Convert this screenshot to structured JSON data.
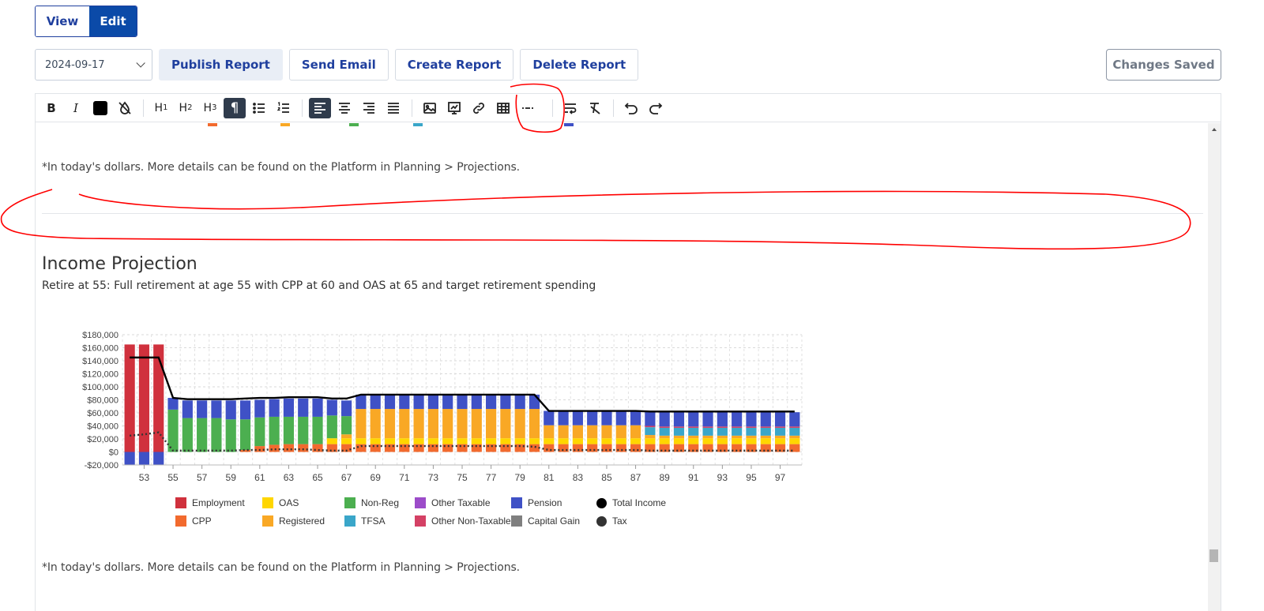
{
  "mode": {
    "view_label": "View",
    "edit_label": "Edit",
    "active": "edit"
  },
  "actions": {
    "date_value": "2024-09-17",
    "publish_label": "Publish Report",
    "email_label": "Send Email",
    "create_label": "Create Report",
    "delete_label": "Delete Report",
    "saved_label": "Changes Saved"
  },
  "toolbar": {
    "bold": "B",
    "italic": "I",
    "h1": "H",
    "h2": "H",
    "h3": "H",
    "h1_sub": "1",
    "h2_sub": "2",
    "h3_sub": "3",
    "paragraph": "¶"
  },
  "content": {
    "note_top": "*In today's dollars. More details can be found on the Platform in Planning > Projections.",
    "section_title": "Income Projection",
    "section_subtitle": "Retire at 55: Full retirement at age 55 with CPP at 60 and OAS at 65 and target retirement spending",
    "note_bottom": "*In today's dollars. More details can be found on the Platform in Planning > Projections."
  },
  "colors": {
    "employment": "#d0313d",
    "cpp": "#f26a2e",
    "oas": "#ffd600",
    "registered": "#f9a825",
    "non_reg": "#4caf50",
    "tfsa": "#3aa6c9",
    "other_taxable": "#9c4cc9",
    "other_non_taxable": "#d44165",
    "pension": "#3f51c6",
    "capital_gain": "#7f7f7f",
    "total_income": "#000000",
    "tax": "#333333",
    "brand": "#0b4aa8",
    "annotation": "#ff0000"
  },
  "chart_data": {
    "type": "bar",
    "stacked": true,
    "x": [
      52,
      53,
      54,
      55,
      56,
      57,
      58,
      59,
      60,
      61,
      62,
      63,
      64,
      65,
      66,
      67,
      68,
      69,
      70,
      71,
      72,
      73,
      74,
      75,
      76,
      77,
      78,
      79,
      80,
      81,
      82,
      83,
      84,
      85,
      86,
      87,
      88,
      89,
      90,
      91,
      92,
      93,
      94,
      95,
      96,
      97,
      98
    ],
    "x_tick_labels": [
      "53",
      "55",
      "57",
      "59",
      "61",
      "63",
      "65",
      "67",
      "69",
      "71",
      "73",
      "75",
      "77",
      "79",
      "81",
      "83",
      "85",
      "87",
      "89",
      "91",
      "93",
      "95",
      "97"
    ],
    "ylim": [
      -20000,
      180000
    ],
    "y_tick_labels": [
      "$180,000",
      "$160,000",
      "$140,000",
      "$120,000",
      "$100,000",
      "$80,000",
      "$60,000",
      "$40,000",
      "$20,000",
      "$0",
      "-$20,000"
    ],
    "grid": true,
    "legend_position": "bottom",
    "legend": [
      "Employment",
      "CPP",
      "OAS",
      "Registered",
      "Non-Reg",
      "TFSA",
      "Other Taxable",
      "Other Non-Taxable",
      "Pension",
      "Capital Gain",
      "Total Income",
      "Tax"
    ],
    "series": [
      {
        "name": "Employment",
        "key": "employment",
        "values": [
          165000,
          165000,
          165000,
          0,
          0,
          0,
          0,
          0,
          0,
          0,
          0,
          0,
          0,
          0,
          0,
          0,
          0,
          0,
          0,
          0,
          0,
          0,
          0,
          0,
          0,
          0,
          0,
          0,
          0,
          0,
          0,
          0,
          0,
          0,
          0,
          0,
          0,
          0,
          0,
          0,
          0,
          0,
          0,
          0,
          0,
          0,
          0
        ]
      },
      {
        "name": "CPP",
        "key": "cpp",
        "values": [
          0,
          0,
          0,
          0,
          0,
          0,
          0,
          0,
          3000,
          9000,
          11000,
          12000,
          12000,
          12000,
          12000,
          12000,
          12000,
          12000,
          12000,
          12000,
          12000,
          12000,
          12000,
          12000,
          12000,
          12000,
          12000,
          12000,
          12000,
          12000,
          12000,
          12000,
          12000,
          12000,
          12000,
          12000,
          12000,
          12000,
          12000,
          12000,
          12000,
          12000,
          12000,
          12000,
          12000,
          12000,
          12000
        ]
      },
      {
        "name": "OAS",
        "key": "oas",
        "values": [
          0,
          0,
          0,
          0,
          0,
          0,
          0,
          0,
          0,
          0,
          0,
          0,
          0,
          0,
          9000,
          9000,
          9000,
          9000,
          9000,
          9000,
          9000,
          9000,
          9000,
          9000,
          9000,
          9000,
          9000,
          9000,
          9000,
          9000,
          9000,
          9000,
          9000,
          9000,
          9000,
          9000,
          9000,
          9000,
          9000,
          9000,
          9000,
          9000,
          9000,
          9000,
          9000,
          9000,
          9000
        ]
      },
      {
        "name": "Registered",
        "key": "registered",
        "values": [
          0,
          0,
          0,
          0,
          0,
          0,
          0,
          0,
          0,
          0,
          0,
          0,
          0,
          0,
          0,
          6000,
          45000,
          45000,
          45000,
          45000,
          45000,
          45000,
          45000,
          45000,
          45000,
          45000,
          45000,
          45000,
          45000,
          20000,
          20000,
          20000,
          20000,
          20000,
          20000,
          20000,
          5000,
          4000,
          4000,
          4000,
          4000,
          4000,
          4000,
          4000,
          4000,
          4000,
          4000
        ]
      },
      {
        "name": "Non-Reg",
        "key": "non_reg",
        "values": [
          0,
          0,
          0,
          65000,
          52000,
          52000,
          52000,
          50000,
          47000,
          44000,
          43000,
          42000,
          42000,
          42000,
          35000,
          28000,
          0,
          0,
          0,
          0,
          0,
          0,
          0,
          0,
          0,
          0,
          0,
          0,
          0,
          0,
          0,
          0,
          0,
          0,
          0,
          0,
          0,
          0,
          0,
          0,
          0,
          0,
          0,
          0,
          0,
          0,
          0
        ]
      },
      {
        "name": "TFSA",
        "key": "tfsa",
        "values": [
          0,
          0,
          0,
          0,
          0,
          0,
          0,
          0,
          0,
          0,
          0,
          0,
          0,
          0,
          0,
          0,
          0,
          0,
          0,
          0,
          0,
          0,
          0,
          0,
          0,
          0,
          0,
          0,
          0,
          0,
          0,
          0,
          0,
          0,
          0,
          0,
          12000,
          12000,
          12000,
          12000,
          12000,
          12000,
          12000,
          12000,
          12000,
          12000,
          12000
        ]
      },
      {
        "name": "Other Taxable",
        "key": "other_taxable",
        "values": [
          0,
          0,
          0,
          0,
          0,
          0,
          0,
          0,
          0,
          0,
          0,
          0,
          0,
          0,
          0,
          0,
          0,
          0,
          0,
          0,
          0,
          0,
          0,
          0,
          0,
          0,
          0,
          0,
          0,
          0,
          0,
          0,
          0,
          0,
          0,
          0,
          0,
          0,
          0,
          0,
          0,
          0,
          0,
          0,
          0,
          0,
          0
        ]
      },
      {
        "name": "Other Non-Taxable",
        "key": "other_non_taxable",
        "values": [
          0,
          0,
          0,
          0,
          0,
          0,
          0,
          0,
          0,
          0,
          0,
          0,
          0,
          0,
          0,
          0,
          0,
          0,
          0,
          0,
          0,
          0,
          0,
          0,
          0,
          0,
          0,
          0,
          0,
          0,
          0,
          0,
          0,
          0,
          0,
          0,
          2000,
          2000,
          2000,
          2000,
          2000,
          2000,
          2000,
          2000,
          2000,
          2000,
          2000
        ]
      },
      {
        "name": "Pension",
        "key": "pension",
        "values": [
          -20000,
          -20000,
          -20000,
          18000,
          27000,
          27000,
          27000,
          29000,
          29000,
          27000,
          27000,
          28000,
          28000,
          28000,
          24000,
          24000,
          22000,
          22000,
          22000,
          22000,
          22000,
          22000,
          22000,
          22000,
          22000,
          22000,
          22000,
          22000,
          22000,
          22000,
          22000,
          22000,
          22000,
          22000,
          22000,
          22000,
          22000,
          22000,
          22000,
          22000,
          22000,
          22000,
          22000,
          22000,
          22000,
          22000,
          22000
        ]
      },
      {
        "name": "Capital Gain",
        "key": "capital_gain",
        "values": [
          0,
          0,
          0,
          0,
          0,
          0,
          0,
          0,
          0,
          0,
          0,
          0,
          0,
          0,
          0,
          0,
          0,
          0,
          0,
          0,
          0,
          0,
          0,
          0,
          0,
          0,
          0,
          0,
          0,
          0,
          0,
          0,
          0,
          0,
          0,
          0,
          0,
          0,
          0,
          0,
          0,
          0,
          0,
          0,
          0,
          0,
          0
        ]
      }
    ],
    "lines": [
      {
        "name": "Total Income",
        "key": "total_income",
        "style": "solid",
        "values": [
          145000,
          145000,
          145000,
          83000,
          81000,
          81000,
          81000,
          81000,
          82000,
          83000,
          83000,
          84000,
          84000,
          84000,
          82000,
          82000,
          88000,
          88000,
          88000,
          88000,
          88000,
          88000,
          88000,
          88000,
          88000,
          88000,
          88000,
          88000,
          88000,
          63000,
          63000,
          63000,
          63000,
          63000,
          63000,
          63000,
          62000,
          62000,
          62000,
          62000,
          62000,
          62000,
          62000,
          62000,
          62000,
          62000,
          62000
        ]
      },
      {
        "name": "Tax",
        "key": "tax",
        "style": "dotted",
        "values": [
          25000,
          27000,
          30000,
          2000,
          2000,
          2000,
          2000,
          2000,
          3000,
          3000,
          4000,
          4000,
          4000,
          3000,
          2000,
          2000,
          9000,
          9000,
          9000,
          9000,
          9000,
          9000,
          9000,
          9000,
          9000,
          9000,
          9000,
          9000,
          8000,
          3000,
          3000,
          3000,
          3000,
          3000,
          3000,
          3000,
          2000,
          2000,
          2000,
          2000,
          2000,
          2000,
          2000,
          2000,
          2000,
          2000,
          2000
        ]
      }
    ]
  }
}
